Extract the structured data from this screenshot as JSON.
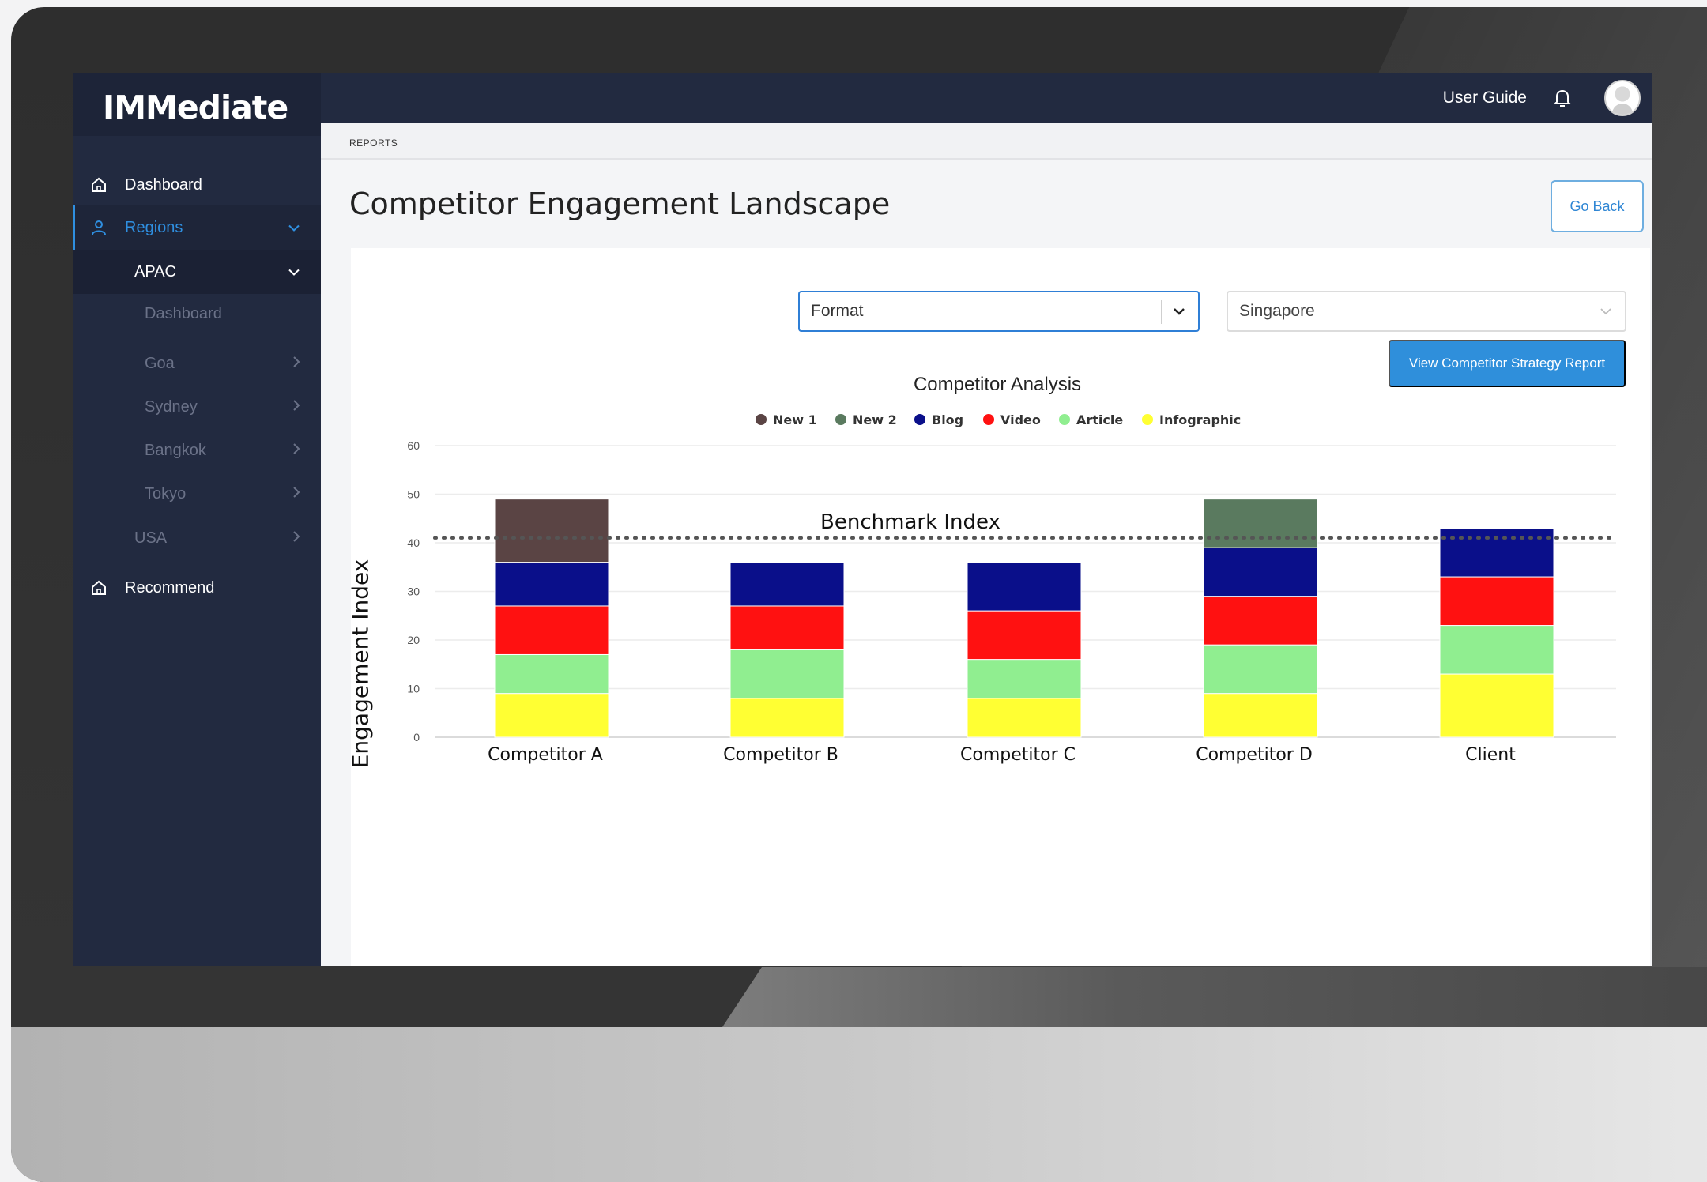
{
  "app": {
    "logo": "IMMediate",
    "user_guide": "User Guide"
  },
  "sidebar": {
    "dashboard": "Dashboard",
    "regions": "Regions",
    "apac": "APAC",
    "apac_items": [
      "Dashboard",
      "Goa",
      "Sydney",
      "Bangkok",
      "Tokyo"
    ],
    "usa": "USA",
    "recommend": "Recommend"
  },
  "breadcrumb": "REPORTS",
  "page": {
    "title": "Competitor Engagement Landscape",
    "go_back": "Go Back"
  },
  "filters": {
    "format": "Format",
    "city": "Singapore"
  },
  "actions": {
    "strategy_report": "View Competitor Strategy Report"
  },
  "colors": {
    "accent": "#2f8fdb",
    "sidebar_bg": "#222a40"
  },
  "chart_data": {
    "type": "bar",
    "stacked": true,
    "title": "Competitor Analysis",
    "ylabel": "Engagement Index",
    "xlabel": "",
    "ylim": [
      0,
      60
    ],
    "yticks": [
      0,
      10,
      20,
      30,
      40,
      50,
      60
    ],
    "categories": [
      "Competitor A",
      "Competitor B",
      "Competitor C",
      "Competitor D",
      "Client"
    ],
    "benchmark": {
      "label": "Benchmark Index",
      "value": 41
    },
    "legend_position": "top",
    "grid": true,
    "series": [
      {
        "name": "Infographic",
        "color": "#ffff33",
        "values": [
          9,
          8,
          8,
          9,
          13
        ]
      },
      {
        "name": "Article",
        "color": "#90ee90",
        "values": [
          8,
          10,
          8,
          10,
          10
        ]
      },
      {
        "name": "Video",
        "color": "#ff1111",
        "values": [
          10,
          9,
          10,
          10,
          10
        ]
      },
      {
        "name": "Blog",
        "color": "#0a0f8a",
        "values": [
          9,
          9,
          10,
          10,
          10
        ]
      },
      {
        "name": "New 2",
        "color": "#5a7a5f",
        "values": [
          0,
          0,
          0,
          10,
          0
        ]
      },
      {
        "name": "New 1",
        "color": "#5a4444",
        "values": [
          13,
          0,
          0,
          0,
          0
        ]
      }
    ],
    "legend_order": [
      "New 1",
      "New 2",
      "Blog",
      "Video",
      "Article",
      "Infographic"
    ]
  }
}
